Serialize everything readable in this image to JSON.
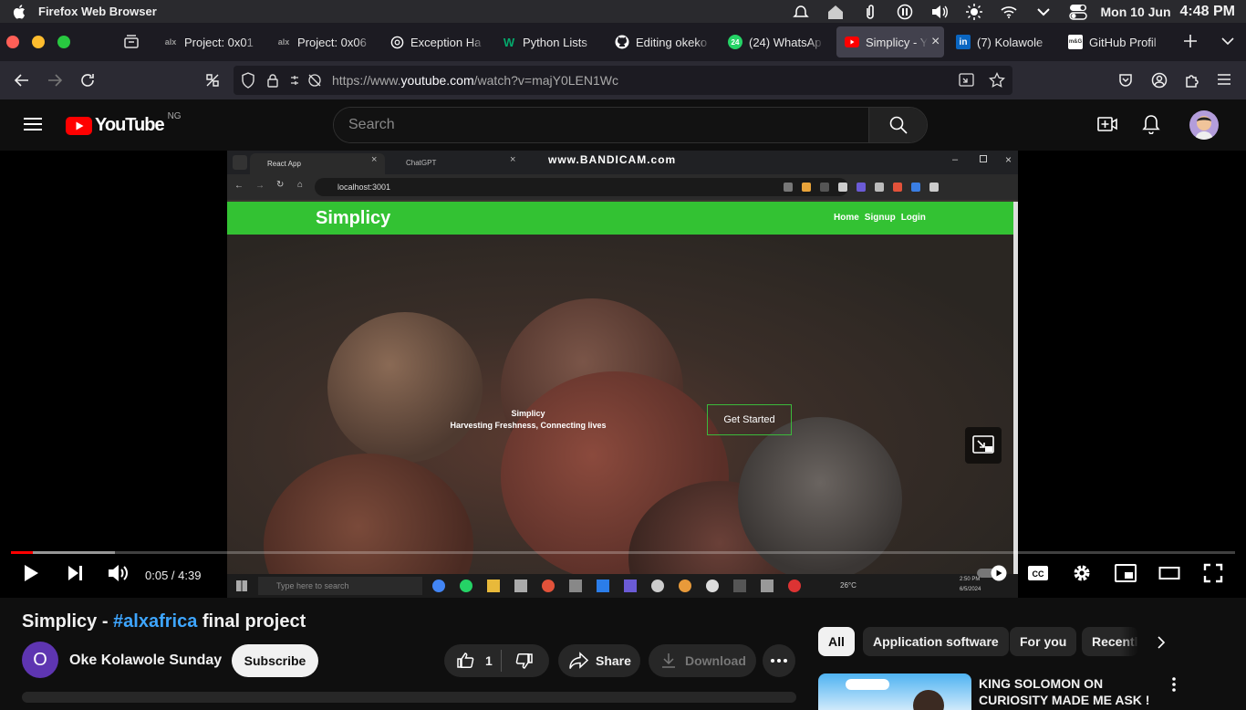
{
  "menubar": {
    "app_name": "Firefox Web Browser",
    "date": "Mon 10 Jun",
    "time": "4:48 PM"
  },
  "tabs": [
    {
      "label": "Project: 0x01",
      "favicon": "alx-icon"
    },
    {
      "label": "Project: 0x06",
      "favicon": "alx-icon"
    },
    {
      "label": "Exception Ha",
      "favicon": "openai-icon"
    },
    {
      "label": "Python Lists",
      "favicon": "w3-icon"
    },
    {
      "label": "Editing okeko",
      "favicon": "github-icon"
    },
    {
      "label": "(24) WhatsAp",
      "favicon": "whatsapp-icon",
      "badge": "24"
    },
    {
      "label": "Simplicy - Y",
      "favicon": "youtube-icon",
      "active": true
    },
    {
      "label": "(7) Kolawole",
      "favicon": "linkedin-icon"
    },
    {
      "label": "GitHub Profil",
      "favicon": "github-profile-icon",
      "fav_text": "m&G"
    }
  ],
  "navbar": {
    "url_prefix": "https://www.",
    "url_host": "youtube.com",
    "url_path": "/watch?v=majY0LEN1Wc"
  },
  "youtube": {
    "logo_text": "YouTube",
    "region": "NG",
    "search_placeholder": "Search"
  },
  "video_frame": {
    "inner_tab1": "React App",
    "inner_tab2": "ChatGPT",
    "watermark": "www.BANDICAM.com",
    "inner_url": "localhost:3001",
    "site_logo": "Simplicy",
    "nav_home": "Home",
    "nav_signup": "Signup",
    "nav_login": "Login",
    "hero_title": "Simplicy",
    "hero_subtitle": "Harvesting Freshness, Connecting lives",
    "cta": "Get Started",
    "taskbar_search": "Type here to search",
    "temperature": "26°C",
    "clock": "2:50 PM",
    "clock_date": "6/5/2024"
  },
  "player": {
    "time_display": "0:05 / 4:39",
    "played_fraction": 0.018,
    "buffered_fraction": 0.085
  },
  "video": {
    "title_prefix": "Simplicy - ",
    "title_tag": "#alxafrica",
    "title_suffix": " final project",
    "channel_initial": "O",
    "channel_name": "Oke Kolawole Sunday",
    "subscribe": "Subscribe",
    "likes": "1",
    "share": "Share",
    "download": "Download"
  },
  "chips": [
    "All",
    "Application software",
    "For you",
    "Recently uploaded"
  ],
  "related": {
    "title": "KING SOLOMON ON CURIOSITY MADE ME ASK !"
  },
  "colors": {
    "accent_red": "#ff0000",
    "link_blue": "#3ea6ff",
    "site_green": "#33c233"
  }
}
